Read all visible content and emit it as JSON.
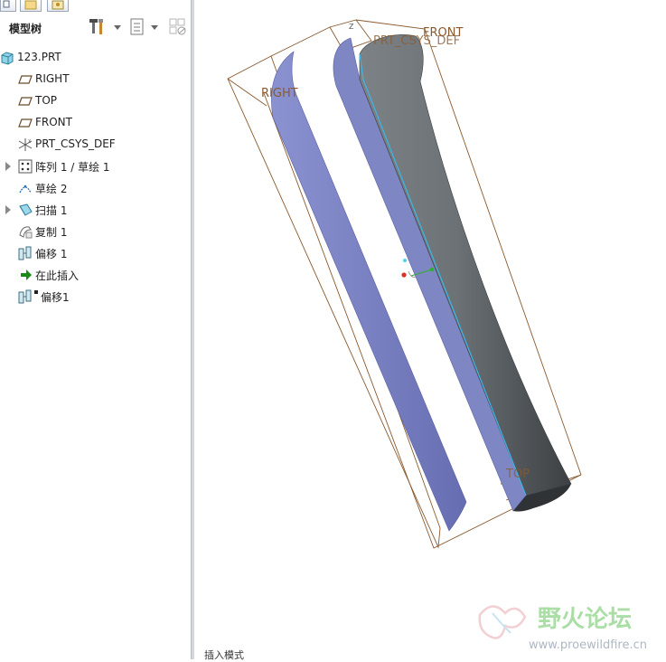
{
  "sidebar": {
    "title": "模型树",
    "icons": {
      "settings": "tools-hammer-icon",
      "show": "list-icon",
      "filter": "filter-icon"
    },
    "items": [
      {
        "label": "123.PRT",
        "icon": "part-icon",
        "expandable": false
      },
      {
        "label": "RIGHT",
        "icon": "datum-plane-icon",
        "expandable": false
      },
      {
        "label": "TOP",
        "icon": "datum-plane-icon",
        "expandable": false
      },
      {
        "label": "FRONT",
        "icon": "datum-plane-icon",
        "expandable": false
      },
      {
        "label": "PRT_CSYS_DEF",
        "icon": "csys-icon",
        "expandable": false
      },
      {
        "label": "阵列 1 / 草绘 1",
        "icon": "pattern-icon",
        "expandable": true
      },
      {
        "label": "草绘 2",
        "icon": "sketch-icon",
        "expandable": false
      },
      {
        "label": "扫描 1",
        "icon": "sweep-icon",
        "expandable": true
      },
      {
        "label": "复制 1",
        "icon": "copy-icon",
        "expandable": false
      },
      {
        "label": "偏移 1",
        "icon": "offset-icon",
        "expandable": false
      },
      {
        "label": "在此插入",
        "icon": "insert-here-arrow-icon",
        "expandable": false
      },
      {
        "label": "偏移1",
        "icon": "offset-icon",
        "expandable": false
      }
    ]
  },
  "viewport": {
    "datum_labels": {
      "right": "RIGHT",
      "front": "FRONT",
      "csys": "PRT_CSYS_DEF",
      "top": "TOP",
      "z_axis": "Z"
    },
    "colors": {
      "datum": "#8a5a2e",
      "surface": "#7f86c4",
      "edge": "#3db6e6",
      "solid_dark": "#3f4447"
    }
  },
  "status": {
    "mode_text": "插入模式"
  },
  "watermark": {
    "title": "野火论坛",
    "url": "www.proewildfire.cn"
  }
}
